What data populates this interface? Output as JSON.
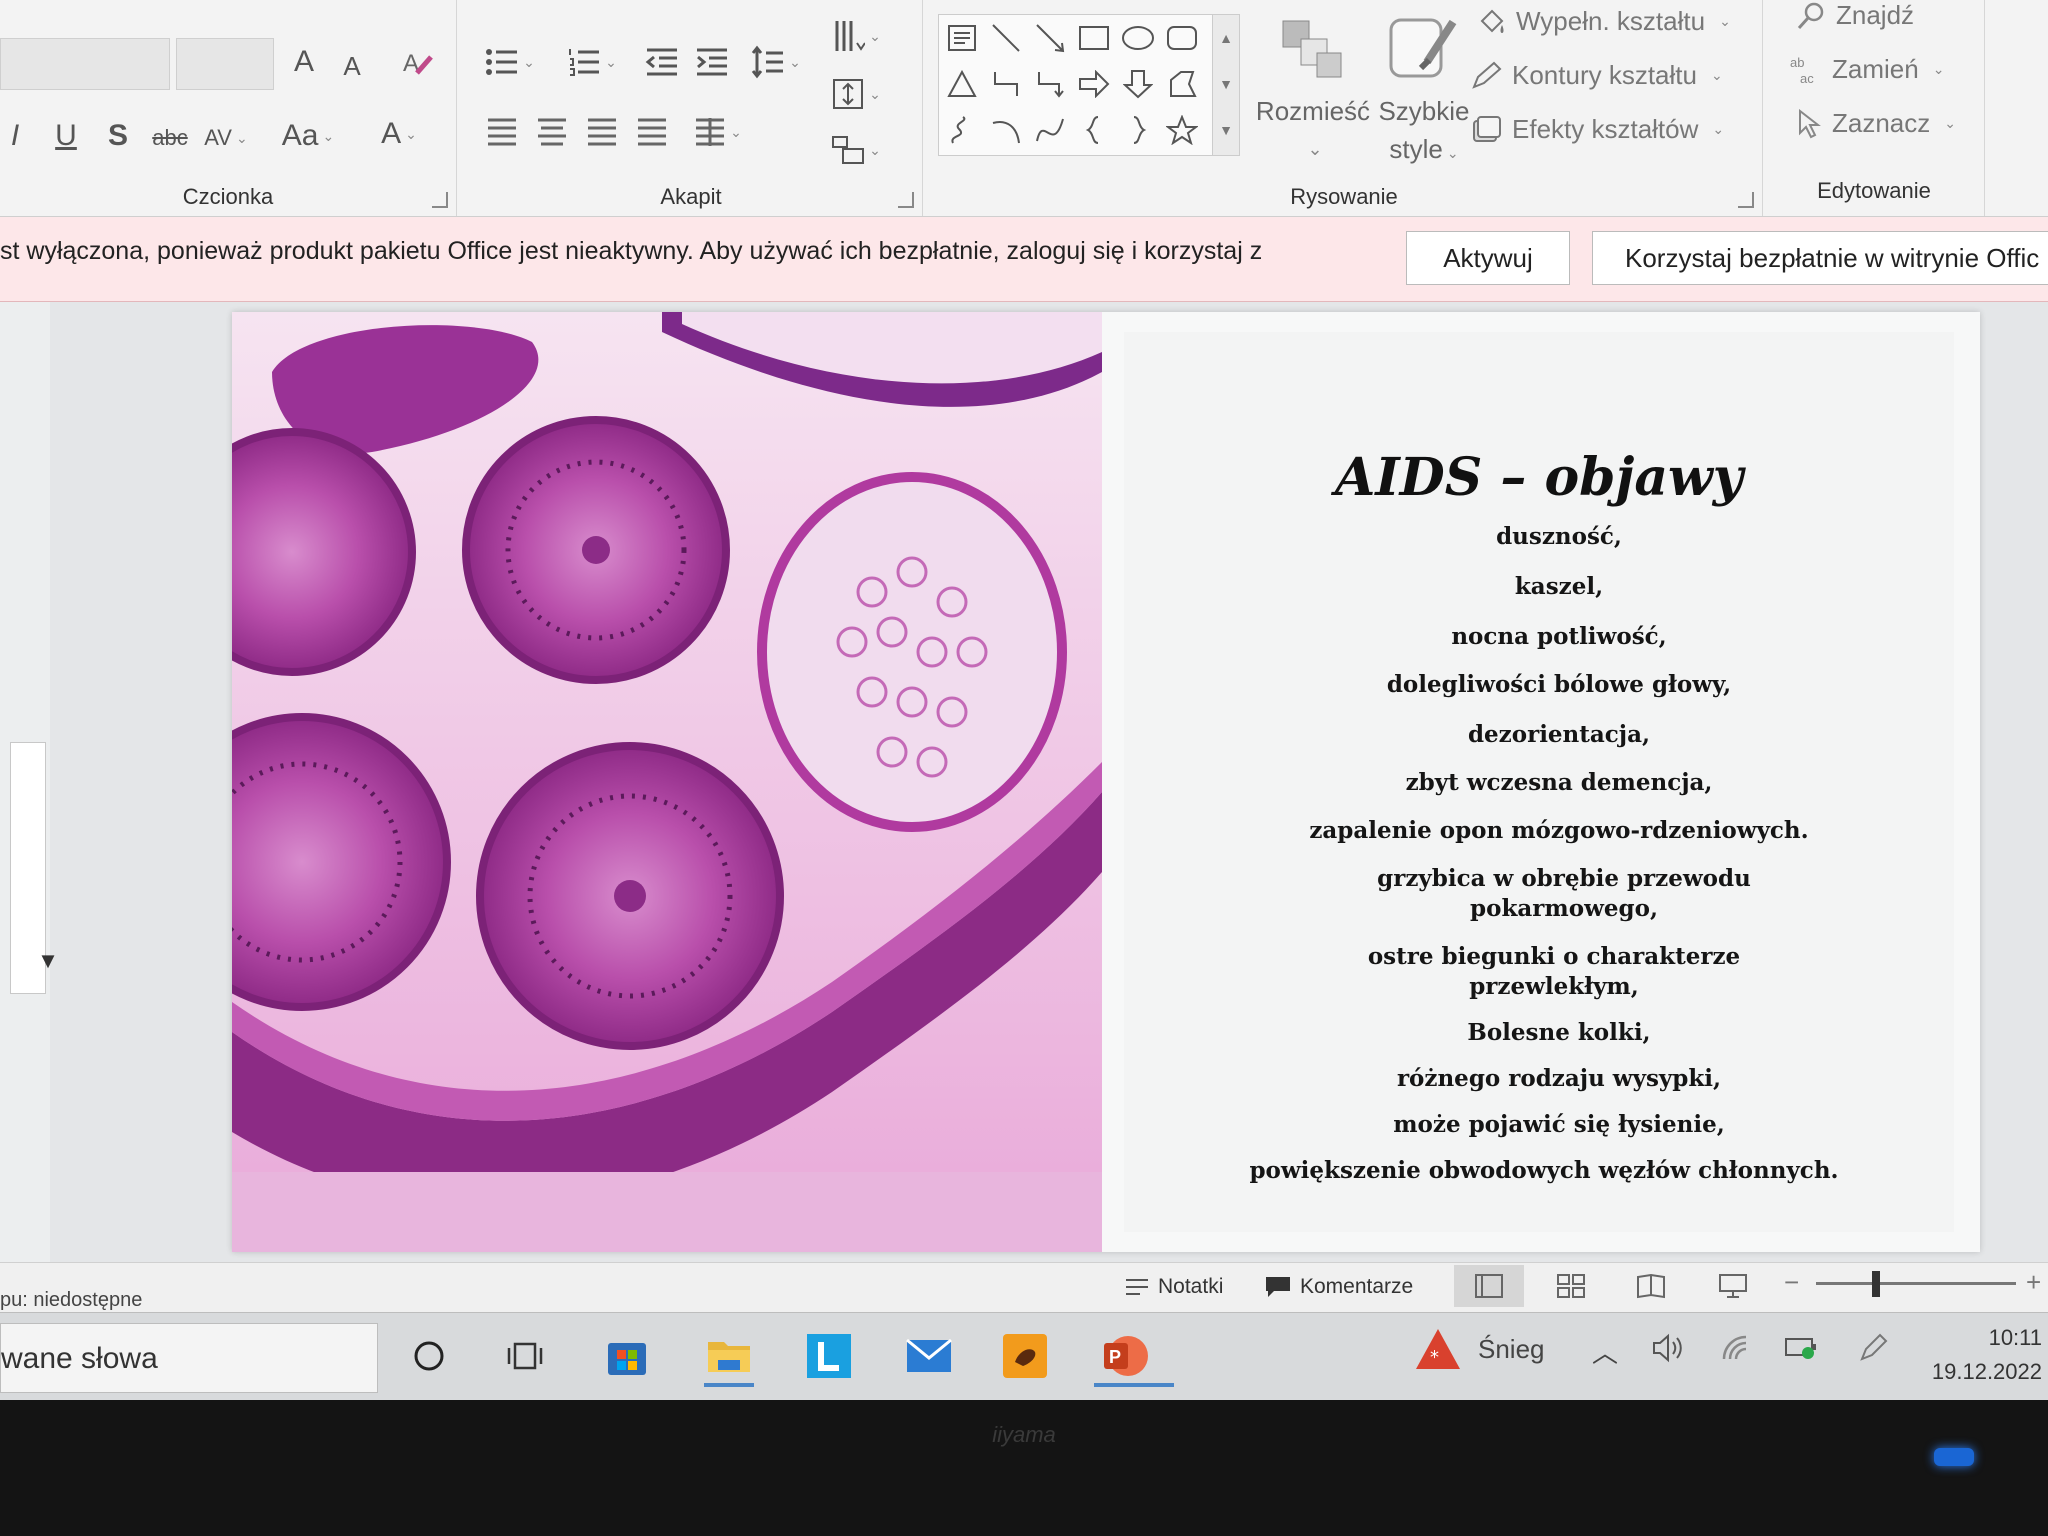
{
  "ribbon": {
    "groups": {
      "font": "Czcionka",
      "paragraph": "Akapit",
      "drawing": "Rysowanie",
      "editing": "Edytowanie"
    },
    "font_buttons": {
      "grow": "A",
      "shrink": "A",
      "italic": "I",
      "underline": "U",
      "strikethrough": "S",
      "strike_abc": "abc",
      "spacing": "AV",
      "case": "Aa",
      "color": "A"
    },
    "arrange": {
      "line1": "Rozmieść"
    },
    "quick_styles": {
      "line1": "Szybkie",
      "line2": "style"
    },
    "fill": "Wypełn. kształtu",
    "outline": "Kontury kształtu",
    "effects": "Efekty kształtów",
    "find": "Znajdź",
    "replace": "Zamień",
    "select": "Zaznacz"
  },
  "message_bar": {
    "text": "st wyłączona, ponieważ produkt pakietu Office jest nieaktywny. Aby używać ich bezpłatnie, zaloguj się i korzystaj z",
    "activate_button": "Aktywuj",
    "free_button": "Korzystaj bezpłatnie w witrynie Offic"
  },
  "slide": {
    "title": "AIDS – objawy",
    "symptoms": [
      "duszność,",
      "kaszel,",
      "nocna potliwość,",
      "dolegliwości bólowe głowy,",
      "dezorientacja,",
      "zbyt wczesna demencja,",
      "zapalenie opon mózgowo-rdzeniowych.",
      "grzybica w obrębie przewodu pokarmowego,",
      "ostre biegunki o charakterze przewlekłym,",
      "Bolesne kolki,",
      "różnego rodzaju wysypki,",
      "może pojawić się łysienie,",
      "powiększenie obwodowych węzłów chłonnych."
    ]
  },
  "status_bar": {
    "left_text": "pu: niedostępne",
    "notes": "Notatki",
    "comments": "Komentarze"
  },
  "taskbar": {
    "search_text": "wane słowa",
    "weather": "Śnieg",
    "time": "10:11",
    "date": "19.12.2022",
    "apps": [
      "cortana-icon",
      "task-view-icon",
      "store-icon",
      "file-explorer-icon",
      "l-app-icon",
      "mail-icon",
      "paint-app-icon",
      "powerpoint-icon"
    ]
  },
  "monitor": {
    "brand": "iiyama"
  },
  "colors": {
    "message_bar_bg": "#fde7e9",
    "stain_magenta": "#b0359c",
    "powerpoint_red": "#d24726",
    "taskbar_accent": "#4a86c8"
  }
}
